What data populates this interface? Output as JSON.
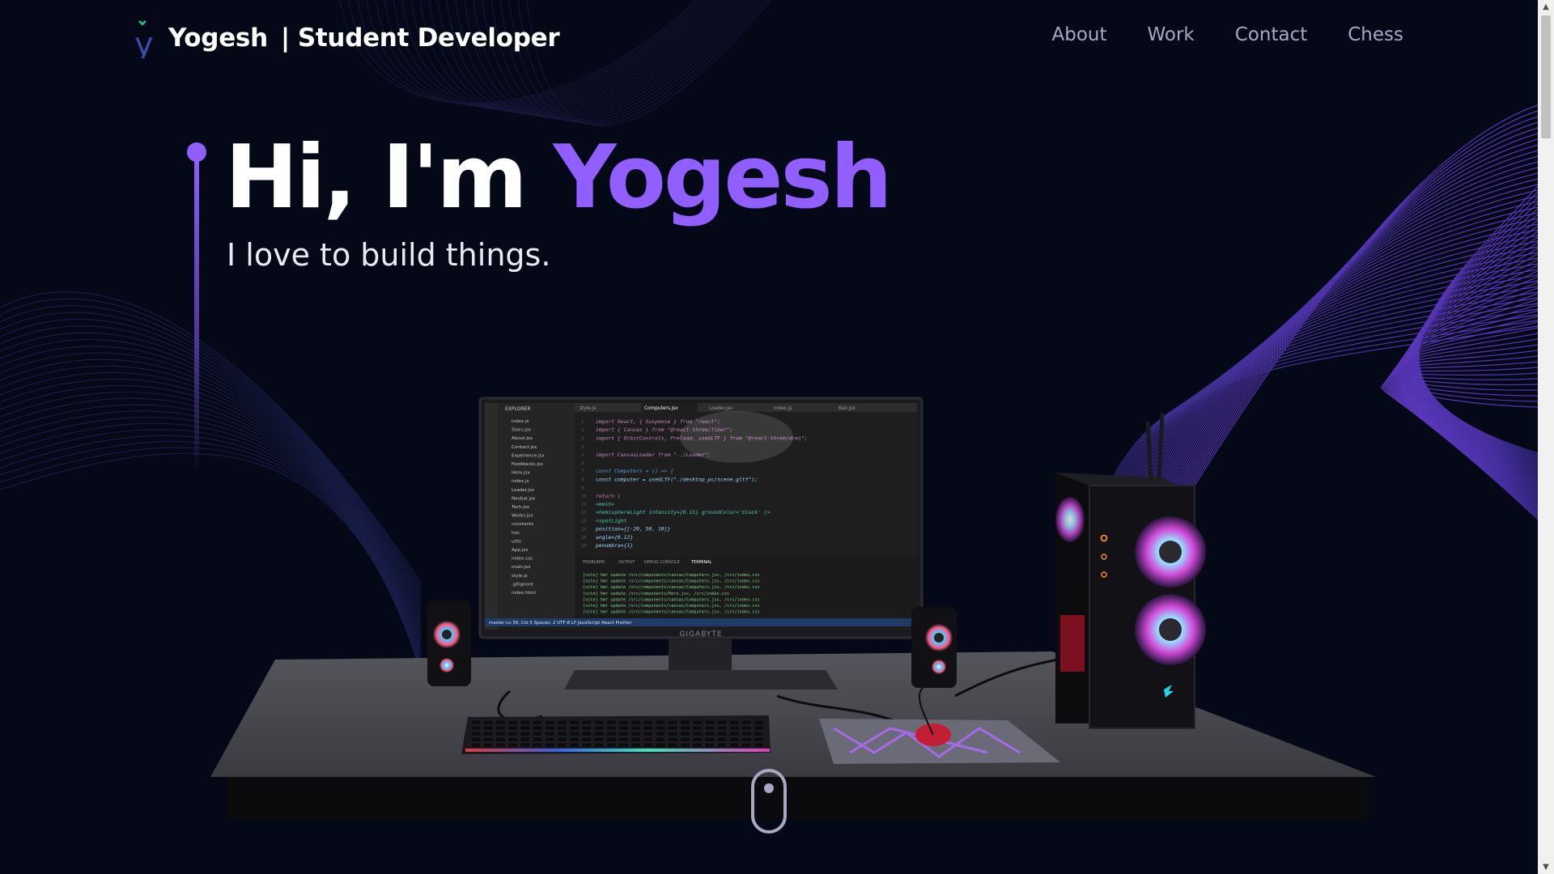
{
  "brand": {
    "logo_letter": "y",
    "name": "Yogesh",
    "separator": "|",
    "role": "Student Developer"
  },
  "nav": {
    "links": [
      {
        "label": "About"
      },
      {
        "label": "Work"
      },
      {
        "label": "Contact"
      },
      {
        "label": "Chess"
      }
    ]
  },
  "hero": {
    "greeting": "Hi, I'm ",
    "name": "Yogesh",
    "subtitle": "I love to build things."
  },
  "scene": {
    "monitor_brand": "GIGABYTE",
    "editor_tabs": [
      "style.js",
      "Computers.jsx",
      "Loader.jsx",
      "index.js",
      "Ball.jsx"
    ],
    "explorer_title": "EXPLORER",
    "explorer_files": [
      "index.js",
      "Stars.jsx",
      "About.jsx",
      "Contact.jsx",
      "Experience.jsx",
      "Feedbacks.jsx",
      "Hero.jsx",
      "index.js",
      "Loader.jsx",
      "Navbar.jsx",
      "Tech.jsx",
      "Works.jsx",
      "constants",
      "hoc",
      "utils",
      "App.jsx",
      "index.css",
      "main.jsx",
      "style.js",
      ".gitignore",
      "index.html"
    ],
    "code_lines": [
      "import React, { Suspense } from \"react\";",
      "import { Canvas } from \"@react-three/fiber\";",
      "import { OrbitControls, Preload, useGLTF } from \"@react-three/drei\";",
      "",
      "import CanvasLoader from \"../Loader\";",
      "",
      "const Computers = () => {",
      "  const computer = useGLTF(\"./desktop_pc/scene.gltf\");",
      "",
      "  return (",
      "    <mesh>",
      "      <hemisphereLight intensity={0.15} groundColor='black' />",
      "      <spotLight",
      "        position={[-20, 50, 10]}",
      "        angle={0.12}",
      "        penumbra={1}"
    ],
    "panel_tabs": [
      "PROBLEMS",
      "OUTPUT",
      "DEBUG CONSOLE",
      "TERMINAL"
    ],
    "terminal_lines": [
      "[vite] hmr update /src/components/canvas/Computers.jsx, /src/index.css",
      "[vite] hmr update /src/components/canvas/Computers.jsx, /src/index.css",
      "[vite] hmr update /src/components/canvas/Computers.jsx, /src/index.css",
      "[vite] hmr update /src/components/Hero.jsx, /src/index.css",
      "[vite] hmr update /src/components/canvas/Computers.jsx, /src/index.css",
      "[vite] hmr update /src/components/canvas/Computers.jsx, /src/index.css",
      "[vite] hmr update /src/components/canvas/Computers.jsx, /src/index.css"
    ],
    "status_bar": "master   Ln 56, Col 5   Spaces: 2   UTF-8   LF   JavaScript React   Prettier"
  },
  "colors": {
    "background": "#050816",
    "accent": "#915eff",
    "nav_text": "#aaa6c3"
  }
}
